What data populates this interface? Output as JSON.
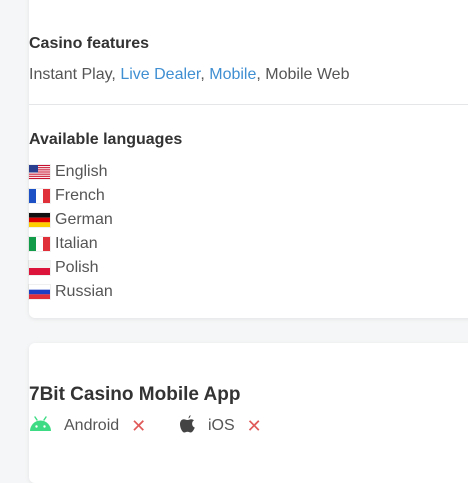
{
  "features": {
    "title": "Casino features",
    "items": [
      {
        "text": "Instant Play",
        "link": false
      },
      {
        "text": "Live Dealer",
        "link": true
      },
      {
        "text": "Mobile",
        "link": true
      },
      {
        "text": "Mobile Web",
        "link": false
      }
    ],
    "separator": ", ",
    "link_color": "#3f8fd2"
  },
  "languages": {
    "title": "Available languages",
    "items": [
      {
        "label": "English",
        "flag": "us-flag-icon"
      },
      {
        "label": "French",
        "flag": "fr-flag-icon"
      },
      {
        "label": "German",
        "flag": "de-flag-icon"
      },
      {
        "label": "Italian",
        "flag": "it-flag-icon"
      },
      {
        "label": "Polish",
        "flag": "pl-flag-icon"
      },
      {
        "label": "Russian",
        "flag": "ru-flag-icon"
      }
    ]
  },
  "mobile_app": {
    "title": "7Bit Casino Mobile App",
    "platforms": [
      {
        "label": "Android",
        "icon": "android-icon",
        "available": false,
        "status_icon": "cross-icon",
        "icon_color": "#3ddc84"
      },
      {
        "label": "iOS",
        "icon": "apple-icon",
        "available": false,
        "status_icon": "cross-icon",
        "icon_color": "#444444"
      }
    ],
    "cross_symbol": "✕",
    "cross_color": "#e05a5a"
  }
}
